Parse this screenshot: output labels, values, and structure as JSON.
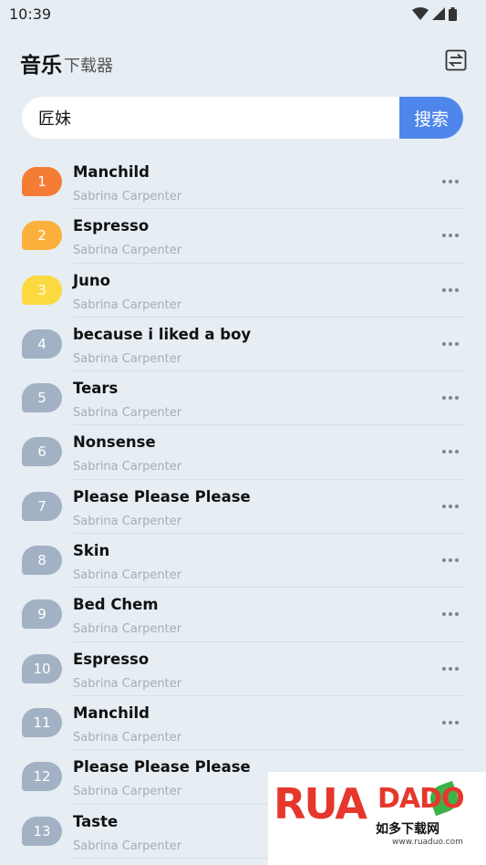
{
  "status_bar": {
    "time": "10:39"
  },
  "header": {
    "title": "音乐",
    "subtitle": "下载器"
  },
  "search": {
    "value": "匠妹",
    "button_label": "搜索"
  },
  "colors": {
    "rank_1": "#f57c35",
    "rank_2": "#fbb03b",
    "rank_3": "#fcd93e",
    "rank_default": "#a3b1c4",
    "accent": "#4f86ec"
  },
  "songs": [
    {
      "rank": "1",
      "title": "Manchild",
      "artist": "Sabrina Carpenter"
    },
    {
      "rank": "2",
      "title": "Espresso",
      "artist": "Sabrina Carpenter"
    },
    {
      "rank": "3",
      "title": "Juno",
      "artist": "Sabrina Carpenter"
    },
    {
      "rank": "4",
      "title": "because i liked a boy",
      "artist": "Sabrina Carpenter"
    },
    {
      "rank": "5",
      "title": "Tears",
      "artist": "Sabrina Carpenter"
    },
    {
      "rank": "6",
      "title": "Nonsense",
      "artist": "Sabrina Carpenter"
    },
    {
      "rank": "7",
      "title": "Please Please Please",
      "artist": "Sabrina Carpenter"
    },
    {
      "rank": "8",
      "title": "Skin",
      "artist": "Sabrina Carpenter"
    },
    {
      "rank": "9",
      "title": "Bed Chem",
      "artist": "Sabrina Carpenter"
    },
    {
      "rank": "10",
      "title": "Espresso",
      "artist": "Sabrina Carpenter"
    },
    {
      "rank": "11",
      "title": "Manchild",
      "artist": "Sabrina Carpenter"
    },
    {
      "rank": "12",
      "title": "Please Please Please",
      "artist": "Sabrina Carpenter"
    },
    {
      "rank": "13",
      "title": "Taste",
      "artist": "Sabrina Carpenter"
    }
  ],
  "watermark": {
    "logo_text": "RUANDUO",
    "site_name": "如多下载网",
    "url": "www.ruaduo.com"
  }
}
